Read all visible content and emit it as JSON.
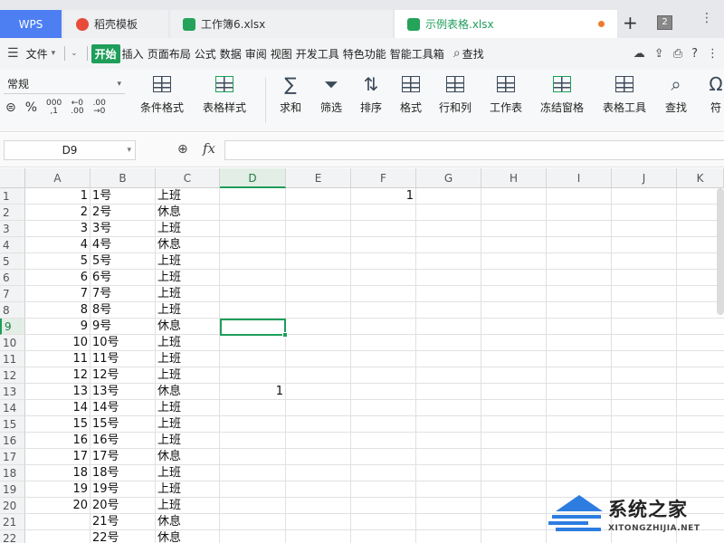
{
  "tabs": [
    {
      "label": "WPS"
    },
    {
      "label": "稻壳模板"
    },
    {
      "label": "工作簿6.xlsx"
    },
    {
      "label": "示例表格.xlsx"
    }
  ],
  "title_badge": "2",
  "menu": {
    "file": "文件",
    "items": [
      "开始",
      "插入",
      "页面布局",
      "公式",
      "数据",
      "审阅",
      "视图",
      "开发工具",
      "特色功能",
      "智能工具箱"
    ],
    "search": "查找"
  },
  "ribbon": {
    "number_format": "常规",
    "buttons": [
      "条件格式",
      "表格样式",
      "求和",
      "筛选",
      "排序",
      "格式",
      "行和列",
      "工作表",
      "冻结窗格",
      "表格工具",
      "查找",
      "符"
    ]
  },
  "formula_bar": {
    "name_box": "D9",
    "fx": "fx",
    "value": ""
  },
  "grid": {
    "columns": [
      "A",
      "B",
      "C",
      "D",
      "E",
      "F",
      "G",
      "H",
      "I",
      "J",
      "K"
    ],
    "selected_column": "D",
    "selected_row": "9",
    "rows": [
      {
        "r": "1",
        "a": "1",
        "b": "1号",
        "c": "上班",
        "d": "",
        "f": "1"
      },
      {
        "r": "2",
        "a": "2",
        "b": "2号",
        "c": "休息",
        "d": "",
        "f": ""
      },
      {
        "r": "3",
        "a": "3",
        "b": "3号",
        "c": "上班",
        "d": "",
        "f": ""
      },
      {
        "r": "4",
        "a": "4",
        "b": "4号",
        "c": "休息",
        "d": "",
        "f": ""
      },
      {
        "r": "5",
        "a": "5",
        "b": "5号",
        "c": "上班",
        "d": "",
        "f": ""
      },
      {
        "r": "6",
        "a": "6",
        "b": "6号",
        "c": "上班",
        "d": "",
        "f": ""
      },
      {
        "r": "7",
        "a": "7",
        "b": "7号",
        "c": "上班",
        "d": "",
        "f": ""
      },
      {
        "r": "8",
        "a": "8",
        "b": "8号",
        "c": "上班",
        "d": "",
        "f": ""
      },
      {
        "r": "9",
        "a": "9",
        "b": "9号",
        "c": "休息",
        "d": "",
        "f": ""
      },
      {
        "r": "10",
        "a": "10",
        "b": "10号",
        "c": "上班",
        "d": "",
        "f": ""
      },
      {
        "r": "11",
        "a": "11",
        "b": "11号",
        "c": "上班",
        "d": "",
        "f": ""
      },
      {
        "r": "12",
        "a": "12",
        "b": "12号",
        "c": "上班",
        "d": "",
        "f": ""
      },
      {
        "r": "13",
        "a": "13",
        "b": "13号",
        "c": "休息",
        "d": "1",
        "f": ""
      },
      {
        "r": "14",
        "a": "14",
        "b": "14号",
        "c": "上班",
        "d": "",
        "f": ""
      },
      {
        "r": "15",
        "a": "15",
        "b": "15号",
        "c": "上班",
        "d": "",
        "f": ""
      },
      {
        "r": "16",
        "a": "16",
        "b": "16号",
        "c": "上班",
        "d": "",
        "f": ""
      },
      {
        "r": "17",
        "a": "17",
        "b": "17号",
        "c": "休息",
        "d": "",
        "f": ""
      },
      {
        "r": "18",
        "a": "18",
        "b": "18号",
        "c": "上班",
        "d": "",
        "f": ""
      },
      {
        "r": "19",
        "a": "19",
        "b": "19号",
        "c": "上班",
        "d": "",
        "f": ""
      },
      {
        "r": "20",
        "a": "20",
        "b": "20号",
        "c": "上班",
        "d": "",
        "f": ""
      },
      {
        "r": "21",
        "a": "",
        "b": "21号",
        "c": "休息",
        "d": "",
        "f": ""
      },
      {
        "r": "22",
        "a": "",
        "b": "22号",
        "c": "休息",
        "d": "",
        "f": ""
      }
    ]
  },
  "watermark": {
    "title": "系统之家",
    "url": "XITONGZHIJIA.NET"
  },
  "colors": {
    "accent": "#1e9e5a",
    "wps_tab": "#4d7ff3"
  }
}
